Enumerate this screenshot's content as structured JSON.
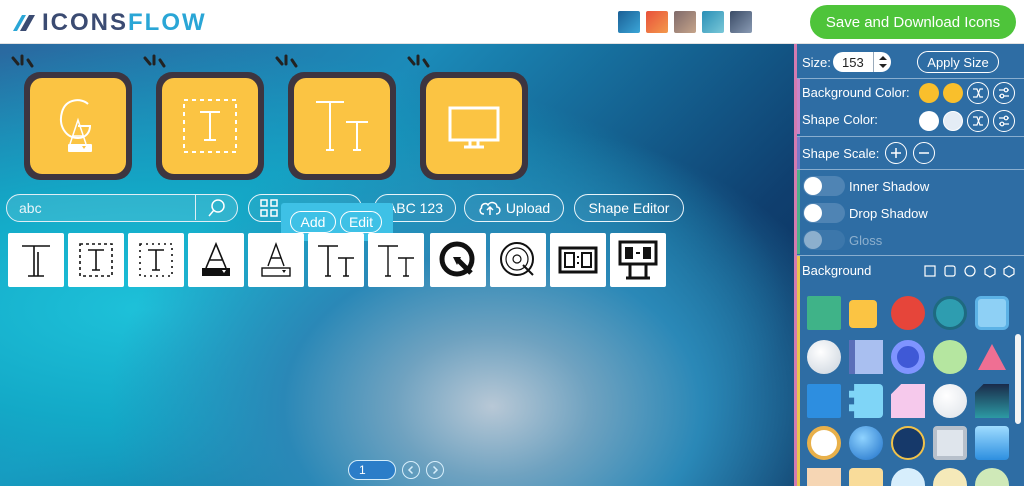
{
  "header": {
    "logo_text_part1": "ICONS",
    "logo_text_part2": "FLOW",
    "save_label": "Save and Download Icons",
    "bg_swatches": [
      "#2a7fb8",
      "#e36a3c",
      "#a58872",
      "#3aa2c4",
      "#5d6f8a"
    ]
  },
  "preview_icons": [
    {
      "name": "font-g-icon"
    },
    {
      "name": "text-frame-icon"
    },
    {
      "name": "font-size-icon"
    },
    {
      "name": "monitor-icon"
    }
  ],
  "toolbar": {
    "search_value": "abc",
    "abc_label": "ABC 123",
    "upload_label": "Upload",
    "shape_editor_label": "Shape Editor",
    "add_label": "Add",
    "edit_label": "Edit"
  },
  "icon_results": [
    "text-T-icon",
    "text-frame-icon",
    "text-frame-icon",
    "font-a-icon",
    "font-a-icon",
    "font-size-icon",
    "font-size-icon",
    "quicktime-icon",
    "quicktime-outline-icon",
    "scoreboard-icon",
    "scoreboard-stand-icon"
  ],
  "pager": {
    "page": "1"
  },
  "panel": {
    "size_label": "Size:",
    "size_value": "153",
    "apply_label": "Apply Size",
    "bg_color_label": "Background Color:",
    "shape_color_label": "Shape Color:",
    "shape_scale_label": "Shape Scale:",
    "inner_shadow_label": "Inner Shadow",
    "drop_shadow_label": "Drop Shadow",
    "gloss_label": "Gloss",
    "background_label": "Background",
    "bg_colors": [
      "#f9bf2c",
      "#f9bf2c"
    ],
    "shape_colors": [
      "#ffffff",
      "#e4ecf5"
    ]
  }
}
